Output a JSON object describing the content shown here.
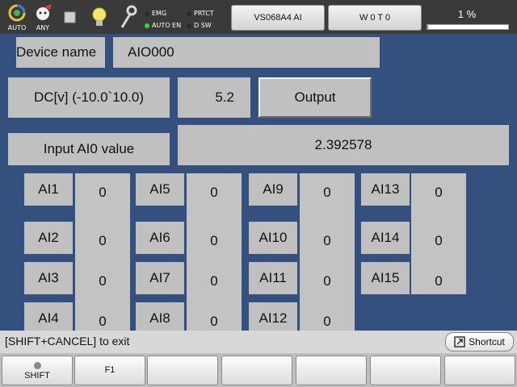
{
  "topbar": {
    "icons": [
      {
        "name": "auto-icon",
        "label": "AUTO"
      },
      {
        "name": "any-icon",
        "label": "ANY"
      },
      {
        "name": "stop-icon",
        "label": ""
      },
      {
        "name": "lightbulb-icon",
        "label": ""
      },
      {
        "name": "wrench-icon",
        "label": ""
      }
    ],
    "indicators": [
      {
        "label": "EMG",
        "color": "#2a2a2a"
      },
      {
        "label": "PRTCT",
        "color": "#2a2a2a"
      },
      {
        "label": "AUTO EN",
        "color": "#46d040"
      },
      {
        "label": "D SW",
        "color": "#2a2a2a"
      }
    ],
    "program_button": "VS068A4 AI",
    "work_button": "W 0 T 0",
    "progress_text": "1 %",
    "progress_percent": 1,
    "progress_color": "#4a90d9"
  },
  "device": {
    "label": "Device name",
    "value": "AIO000"
  },
  "output": {
    "label": "DC[v] (-10.0`10.0)",
    "value": "5.2",
    "button": "Output"
  },
  "input": {
    "label": "Input AI0 value",
    "value": "2.392578"
  },
  "channels": [
    [
      {
        "label": "AI1",
        "value": "0"
      },
      {
        "label": "AI2",
        "value": "0"
      },
      {
        "label": "AI3",
        "value": "0"
      },
      {
        "label": "AI4",
        "value": "0"
      }
    ],
    [
      {
        "label": "AI5",
        "value": "0"
      },
      {
        "label": "AI6",
        "value": "0"
      },
      {
        "label": "AI7",
        "value": "0"
      },
      {
        "label": "AI8",
        "value": "0"
      }
    ],
    [
      {
        "label": "AI9",
        "value": "0"
      },
      {
        "label": "AI10",
        "value": "0"
      },
      {
        "label": "AI11",
        "value": "0"
      },
      {
        "label": "AI12",
        "value": "0"
      }
    ],
    [
      {
        "label": "AI13",
        "value": "0"
      },
      {
        "label": "AI14",
        "value": "0"
      },
      {
        "label": "AI15",
        "value": "0"
      }
    ]
  ],
  "status": {
    "exit_text": "[SHIFT+CANCEL] to exit",
    "shortcut": "Shortcut"
  },
  "fkeys": [
    "SHIFT",
    "F1",
    "",
    "",
    "",
    "",
    ""
  ]
}
